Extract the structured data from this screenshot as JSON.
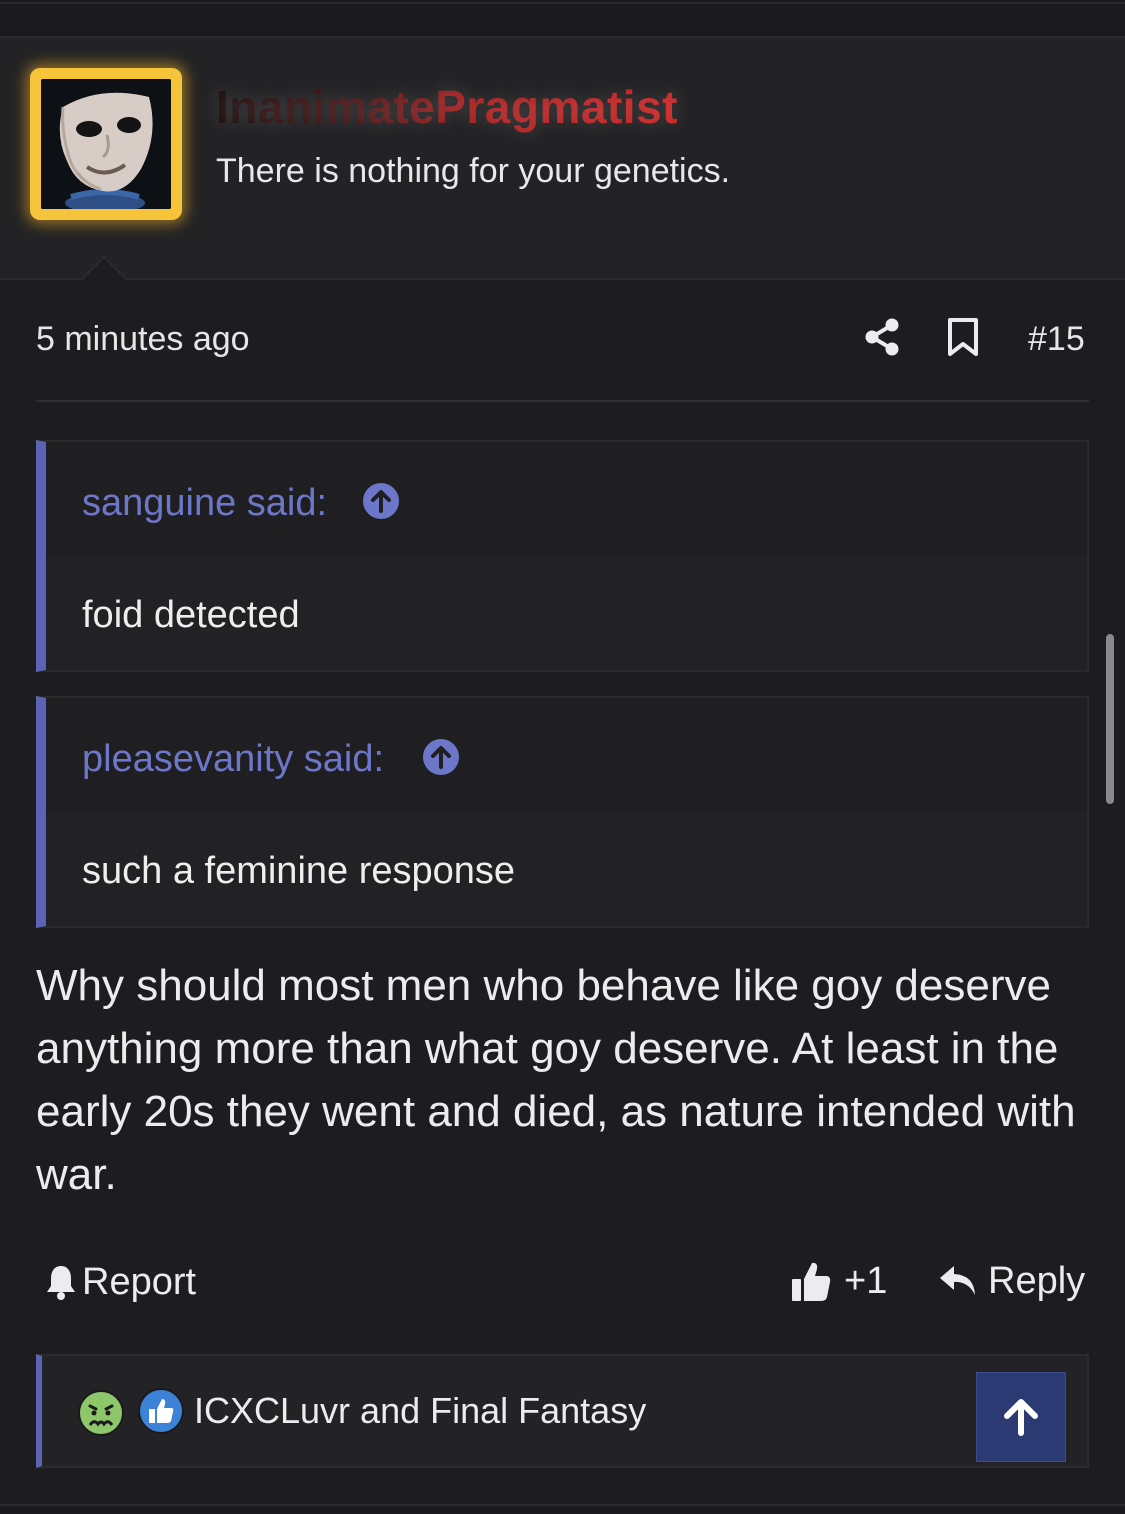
{
  "user": {
    "username": "InanimatePragmatist",
    "title": "There is nothing for your genetics.",
    "avatar_icon": "theater-mask-avatar"
  },
  "post": {
    "time": "5 minutes ago",
    "number": "#15",
    "share_icon": "share-icon",
    "bookmark_icon": "bookmark-icon"
  },
  "quotes": [
    {
      "author": "sanguine said:",
      "body": "foid detected"
    },
    {
      "author": "pleasevanity said:",
      "body": "such a feminine response"
    }
  ],
  "body": "Why should most men who behave like goy deserve anything more than what goy deserve. At least in the early 20s they went and died, as nature intended with war.",
  "actions": {
    "report": "Report",
    "like_count": "+1",
    "reply": "Reply"
  },
  "reactions": {
    "text": "ICXCLuvr and Final Fantasy"
  },
  "colors": {
    "accent": "#5b63b7",
    "quote_author": "#6d77c9",
    "avatar_frame": "#f6c43a",
    "scroll_top_button": "#2c3a73"
  }
}
